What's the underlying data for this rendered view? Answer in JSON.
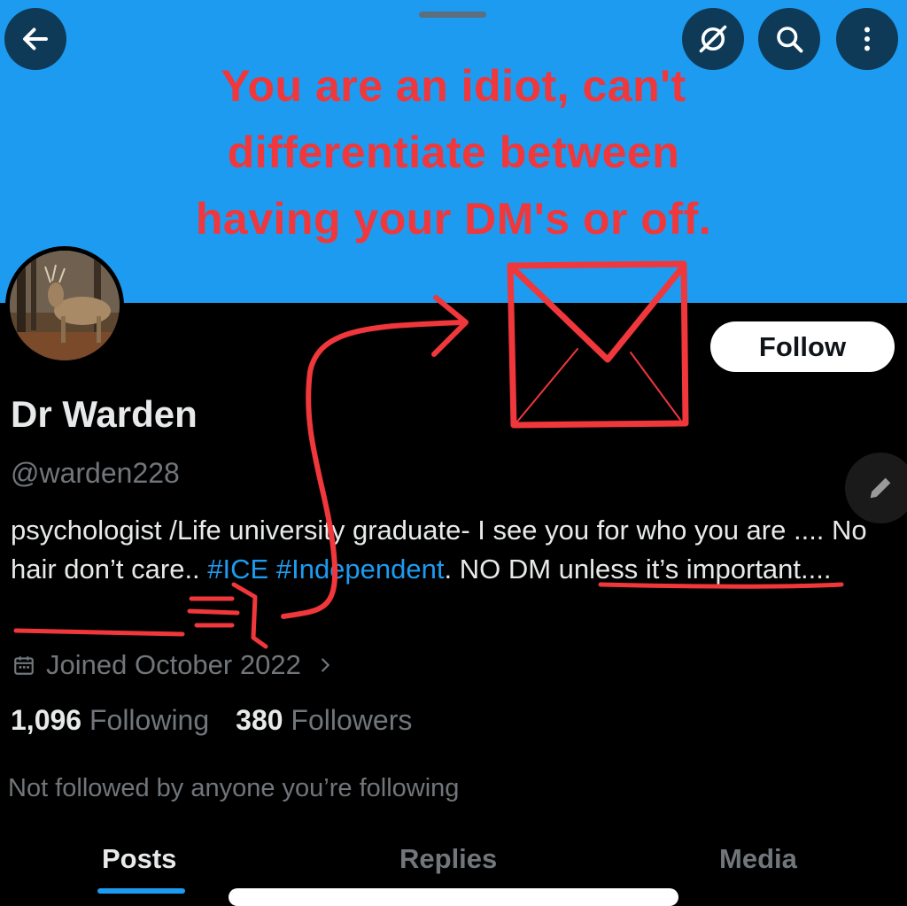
{
  "colors": {
    "banner": "#1d9bf0",
    "annotation": "#f0373b",
    "link": "#1d9bf0"
  },
  "header": {
    "back_icon": "arrow-left-icon",
    "actions": [
      "hide-eye-off-icon",
      "search-icon",
      "more-vertical-icon"
    ]
  },
  "overlay": {
    "line1": "You are an idiot, can't",
    "line2": "differentiate between",
    "line3": "having your DM's or off."
  },
  "profile": {
    "name": "Dr Warden",
    "handle": "@warden228",
    "follow_label": "Follow",
    "bio": {
      "part1": "psychologist /Life university graduate- I see you for who you are .... No hair don’t care.. ",
      "hashtag1": "#ICE",
      "hashtag2": "#Independent",
      "part2": ". NO DM unless it’s important...."
    },
    "joined": "Joined October 2022",
    "following_count": "1,096",
    "following_label": "Following",
    "followers_count": "380",
    "followers_label": "Followers",
    "not_followed": "Not followed by anyone you’re following"
  },
  "tabs": [
    {
      "label": "Posts",
      "active": true
    },
    {
      "label": "Replies",
      "active": false
    },
    {
      "label": "Media",
      "active": false
    }
  ]
}
